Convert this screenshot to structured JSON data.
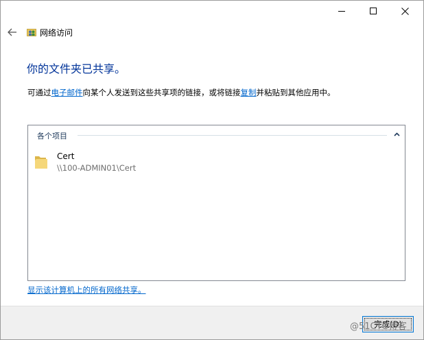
{
  "window": {
    "title": "网络访问"
  },
  "icons": {
    "back": "back-arrow-icon",
    "app": "network-sharing-icon",
    "folder": "folder-icon",
    "collapse": "chevron-up-icon"
  },
  "main": {
    "headline": "你的文件夹已共享。",
    "instruction_prefix": "可通过",
    "email_link": "电子邮件",
    "instruction_middle": "向某个人发送到这些共享项的链接，或将链接",
    "copy_link": "复制",
    "instruction_suffix": "并粘贴到其他应用中。",
    "group_header": "各个项目",
    "items": [
      {
        "name": "Cert",
        "path": "\\\\100-ADMIN01\\Cert"
      }
    ],
    "show_all_link": "显示该计算机上的所有网络共享。"
  },
  "footer": {
    "done_label": "完成(D)",
    "watermark": "@51CTO博客"
  },
  "colors": {
    "headline": "#003399",
    "link": "#0066cc",
    "footer_bg": "#f0f0f0",
    "button_border": "#0078d7"
  }
}
